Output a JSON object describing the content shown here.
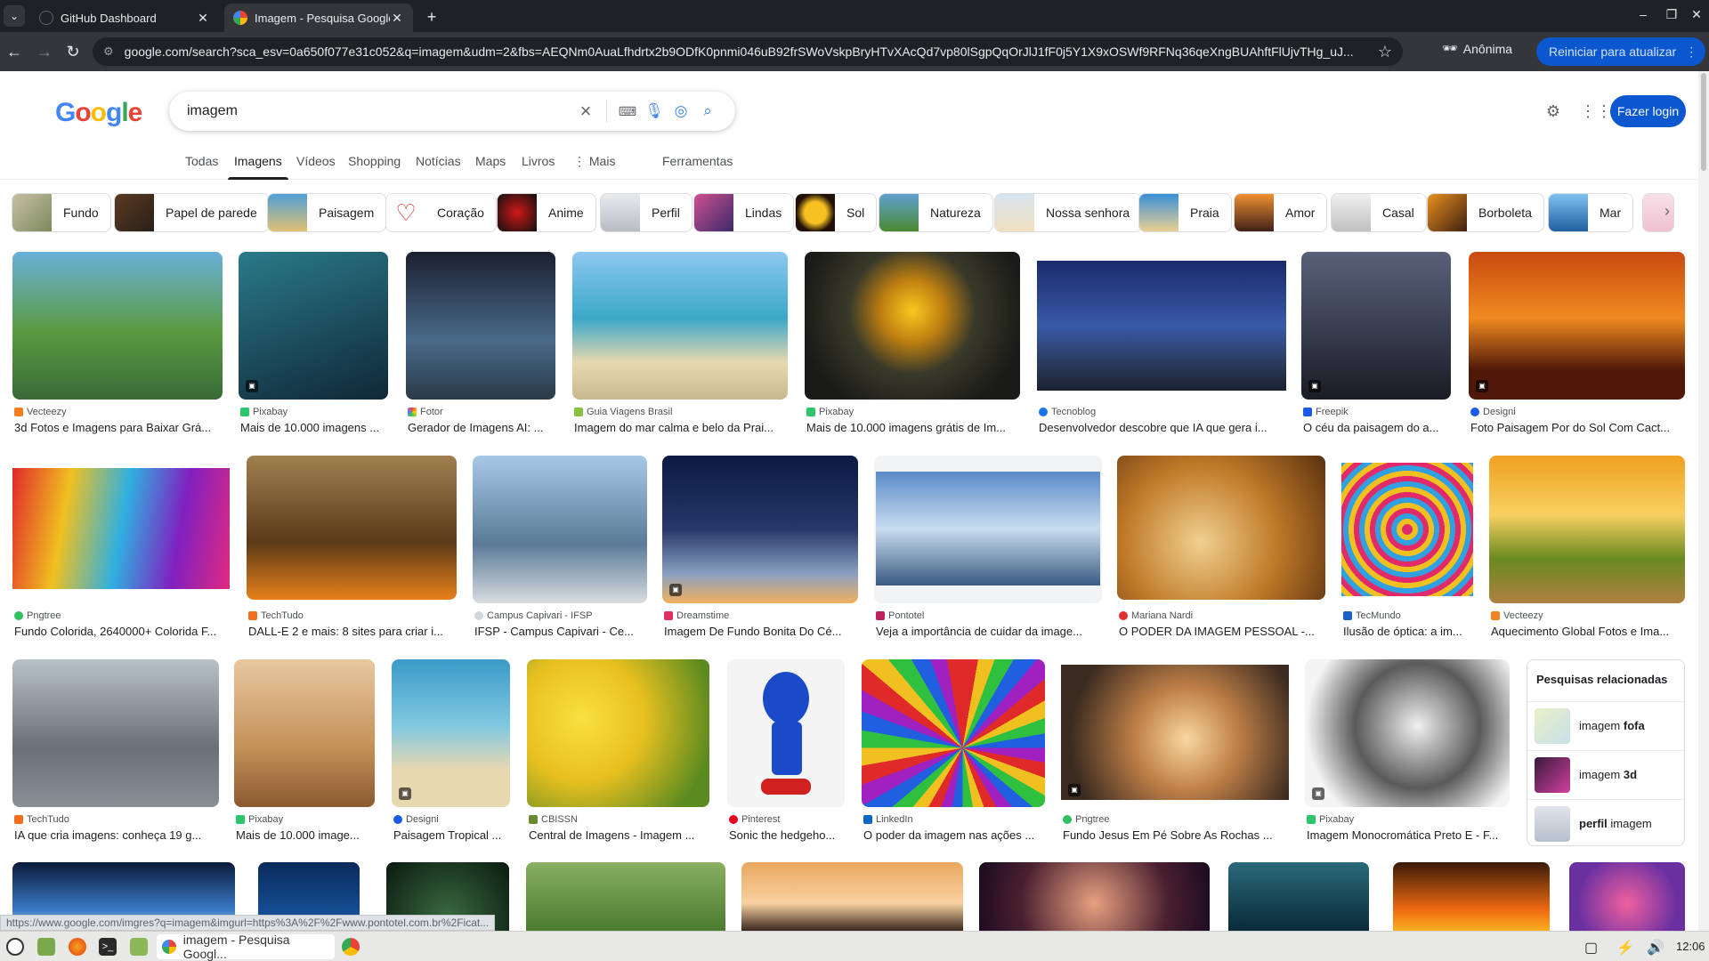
{
  "browser": {
    "tabs": [
      {
        "title": "GitHub Dashboard",
        "active": false
      },
      {
        "title": "Imagem - Pesquisa Google",
        "active": true
      }
    ],
    "url": "google.com/search?sca_esv=0a650f077e31c052&q=imagem&udm=2&fbs=AEQNm0AuaLfhdrtx2b9ODfK0pnmi046uB92frSWoVskpBryHTvXAcQd7vp80lSgpQqOrJlJ1fF0j5Y1X9xOSWf9RFNq36qeXngBUAhftFlUjvTHg_uJ...",
    "incognito_label": "Anônima",
    "update_label": "Reiniciar para atualizar"
  },
  "search": {
    "logo": "Google",
    "query": "imagem",
    "login_label": "Fazer login"
  },
  "nav_tabs": [
    "Todas",
    "Imagens",
    "Vídeos",
    "Shopping",
    "Notícias",
    "Maps",
    "Livros",
    "⋮ Mais",
    "Ferramentas"
  ],
  "chips": [
    "Fundo",
    "Papel de parede",
    "Paisagem",
    "Coração",
    "Anime",
    "Perfil",
    "Lindas",
    "Sol",
    "Natureza",
    "Nossa senhora",
    "Praia",
    "Amor",
    "Casal",
    "Borboleta",
    "Mar"
  ],
  "results": [
    {
      "source": "Vecteezy",
      "title": "3d Fotos e Imagens para Baixar Grá...",
      "color": "#4b8a3c"
    },
    {
      "source": "Pixabay",
      "title": "Mais de 10.000 imagens ...",
      "color": "#1f5e6e"
    },
    {
      "source": "Fotor",
      "title": "Gerador de Imagens AI: ...",
      "color": "#1d2a3c"
    },
    {
      "source": "Guia Viagens Brasil",
      "title": "Imagem do mar calma e belo da Prai...",
      "color": "#4fa8c8"
    },
    {
      "source": "Pixabay",
      "title": "Mais de 10.000 imagens grátis de Im...",
      "color": "#c99a14"
    },
    {
      "source": "Tecnoblog",
      "title": "Desenvolvedor descobre que IA que gera i...",
      "color": "#243c7a"
    },
    {
      "source": "Freepik",
      "title": "O céu da paisagem do a...",
      "color": "#3a3f52"
    },
    {
      "source": "Designi",
      "title": "Foto Paisagem Por do Sol Com Cact...",
      "color": "#e06a12"
    },
    {
      "source": "Pngtree",
      "title": "Fundo Colorida, 2640000+ Colorida F...",
      "color": "#b03080"
    },
    {
      "source": "TechTudo",
      "title": "DALL-E 2 e mais: 8 sites para criar i...",
      "color": "#7a5a22"
    },
    {
      "source": "Campus Capivari - IFSP",
      "title": "IFSP - Campus Capivari - Ce...",
      "color": "#7d98b8"
    },
    {
      "source": "Dreamstime",
      "title": "Imagem De Fundo Bonita Do Cé...",
      "color": "#26386a"
    },
    {
      "source": "Pontotel",
      "title": "Veja a importância de cuidar da image...",
      "color": "#5b84b8"
    },
    {
      "source": "Mariana Nardi",
      "title": "O PODER DA IMAGEM PESSOAL -...",
      "color": "#c07a28"
    },
    {
      "source": "TecMundo",
      "title": "Ilusão de óptica: a im...",
      "color": "#c0407a"
    },
    {
      "source": "Vecteezy",
      "title": "Aquecimento Global Fotos e Ima...",
      "color": "#e8a018"
    },
    {
      "source": "TechTudo",
      "title": "IA que cria imagens: conheça 19 g...",
      "color": "#8a8f96"
    },
    {
      "source": "Pixabay",
      "title": "Mais de 10.000 image...",
      "color": "#c49058"
    },
    {
      "source": "Designi",
      "title": "Paisagem Tropical ...",
      "color": "#3a9ac8"
    },
    {
      "source": "CBISSN",
      "title": "Central de Imagens - Imagem ...",
      "color": "#e8c020"
    },
    {
      "source": "Pinterest",
      "title": "Sonic the hedgeho...",
      "color": "#f0f0f0"
    },
    {
      "source": "LinkedIn",
      "title": "O poder da imagem nas ações ...",
      "color": "#d04080"
    },
    {
      "source": "Pngtree",
      "title": "Fundo Jesus Em Pé Sobre As Rochas ...",
      "color": "#a0683a"
    },
    {
      "source": "Pixabay",
      "title": "Imagem Monocromática Preto E - F...",
      "color": "#4a4a4a"
    }
  ],
  "related": {
    "title": "Pesquisas relacionadas",
    "items": [
      {
        "prefix": "imagem ",
        "bold": "fofa"
      },
      {
        "prefix": "imagem ",
        "bold": "3d"
      },
      {
        "prefix": "",
        "bold": "perfil",
        "suffix": " imagem"
      }
    ]
  },
  "status_url": "https://www.google.com/imgres?q=imagem&imgurl=https%3A%2F%2Fwww.pontotel.com.br%2Ficat...",
  "taskbar": {
    "task_title": "imagem - Pesquisa Googl...",
    "clock": "12:06"
  }
}
